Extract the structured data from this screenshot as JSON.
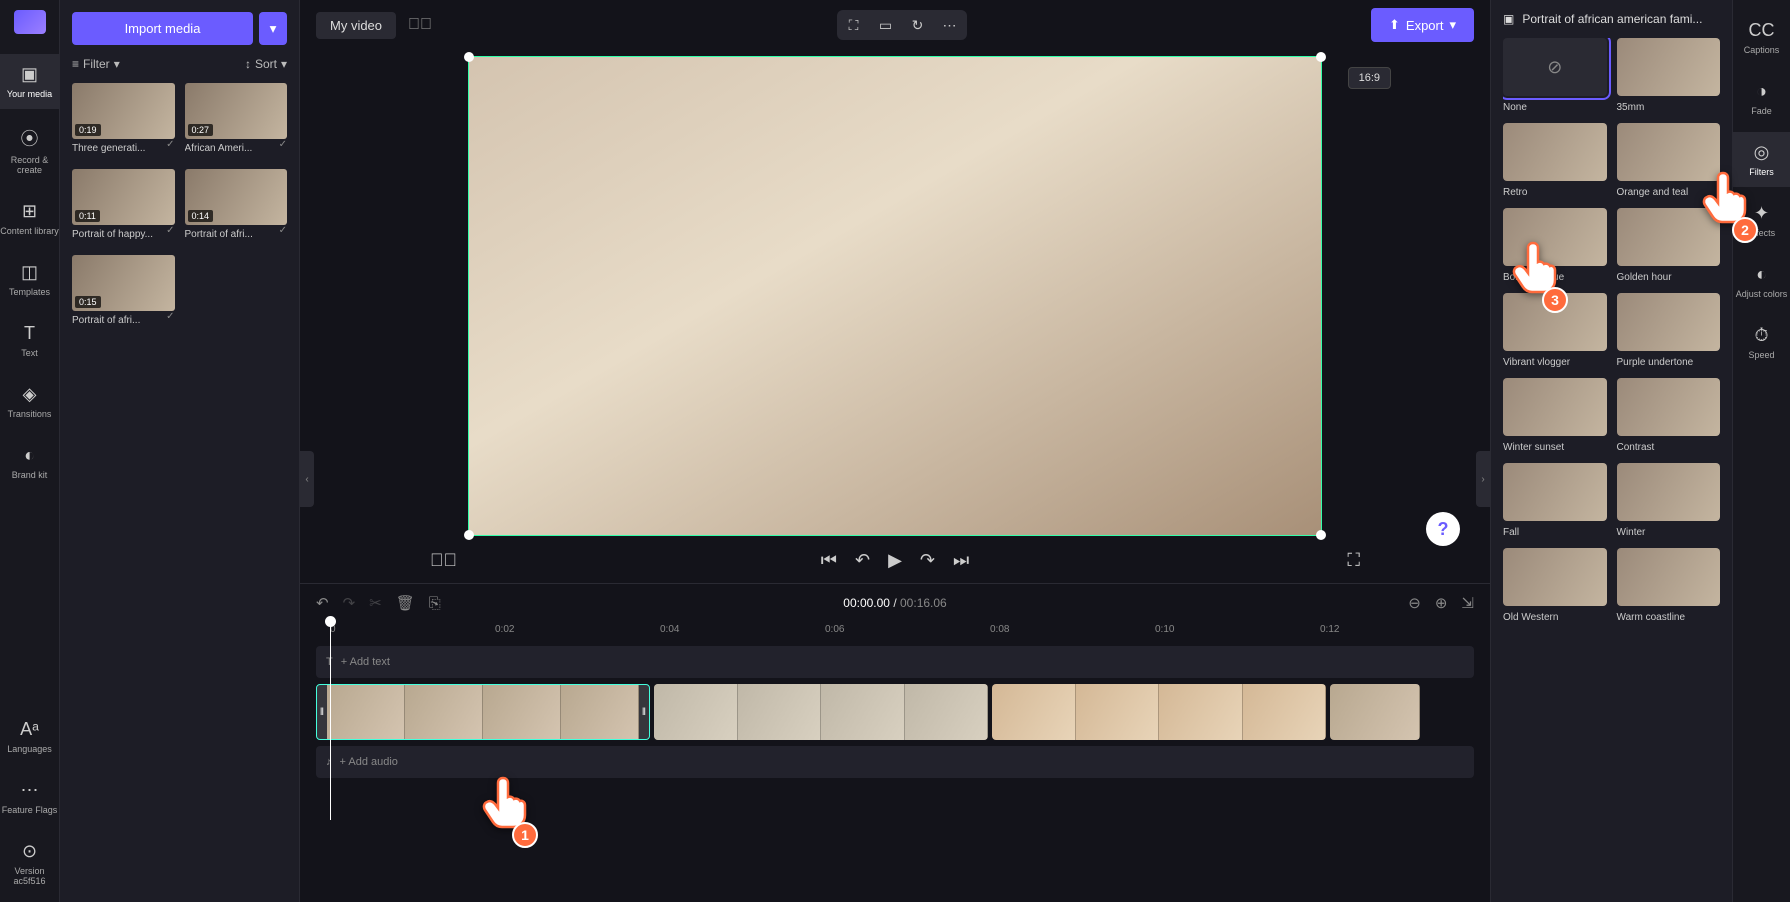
{
  "leftRail": {
    "items": [
      {
        "label": "Your media",
        "icon": "▣"
      },
      {
        "label": "Record & create",
        "icon": "⦿"
      },
      {
        "label": "Content library",
        "icon": "⊞"
      },
      {
        "label": "Templates",
        "icon": "◫"
      },
      {
        "label": "Text",
        "icon": "T"
      },
      {
        "label": "Transitions",
        "icon": "◈"
      },
      {
        "label": "Brand kit",
        "icon": "◐"
      }
    ],
    "bottom": [
      {
        "label": "Languages",
        "icon": "Aᵃ"
      },
      {
        "label": "Feature Flags",
        "icon": "⋯"
      },
      {
        "label": "Version ac5f516",
        "icon": "⊙"
      }
    ]
  },
  "mediaPanel": {
    "importBtn": "Import media",
    "filterBtn": "Filter",
    "sortBtn": "Sort",
    "items": [
      {
        "duration": "0:19",
        "name": "Three generati..."
      },
      {
        "duration": "0:27",
        "name": "African Ameri..."
      },
      {
        "duration": "0:11",
        "name": "Portrait of happy..."
      },
      {
        "duration": "0:14",
        "name": "Portrait of afri..."
      },
      {
        "duration": "0:15",
        "name": "Portrait of afri..."
      }
    ]
  },
  "topBar": {
    "title": "My video",
    "exportBtn": "Export",
    "ratioBadge": "16:9"
  },
  "playerTime": {
    "current": "00:00.00",
    "total": "00:16.06"
  },
  "timeline": {
    "ticks": [
      "0",
      "0:02",
      "0:04",
      "0:06",
      "0:08",
      "0:10",
      "0:12"
    ],
    "addText": "+ Add text",
    "addAudio": "+ Add audio"
  },
  "filtersPanel": {
    "headerTitle": "Portrait of african american fami...",
    "items": [
      {
        "name": "None",
        "none": true,
        "selected": true
      },
      {
        "name": "35mm"
      },
      {
        "name": "Retro"
      },
      {
        "name": "Orange and teal"
      },
      {
        "name": "Bold and blue"
      },
      {
        "name": "Golden hour"
      },
      {
        "name": "Vibrant vlogger"
      },
      {
        "name": "Purple undertone"
      },
      {
        "name": "Winter sunset"
      },
      {
        "name": "Contrast"
      },
      {
        "name": "Fall"
      },
      {
        "name": "Winter"
      },
      {
        "name": "Old Western"
      },
      {
        "name": "Warm coastline"
      }
    ]
  },
  "rightRail": {
    "items": [
      {
        "label": "Captions",
        "icon": "CC"
      },
      {
        "label": "Fade",
        "icon": "◑"
      },
      {
        "label": "Filters",
        "icon": "◎",
        "active": true
      },
      {
        "label": "Effects",
        "icon": "✦"
      },
      {
        "label": "Adjust colors",
        "icon": "◐"
      },
      {
        "label": "Speed",
        "icon": "⏱"
      }
    ]
  },
  "tutorialBadges": {
    "b1": "1",
    "b2": "2",
    "b3": "3"
  }
}
